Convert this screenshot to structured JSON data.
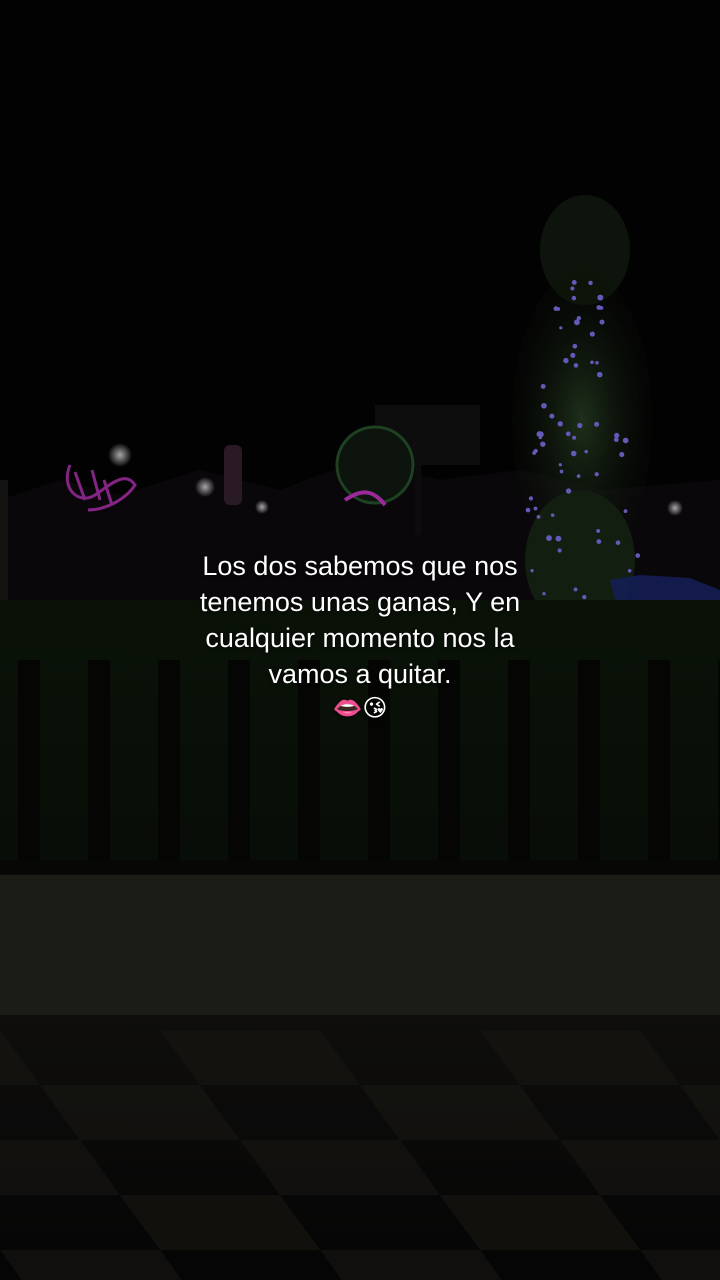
{
  "caption": {
    "lines": [
      "Los dos sabemos que nos",
      "tenemos unas ganas, Y en",
      "cualquier momento nos la",
      "vamos a quitar."
    ],
    "emojis": "👄😘"
  },
  "colors": {
    "sky": "#050405",
    "grass": "#0f1a0c",
    "neon_pink": "#d63bd6",
    "tree_lights": "#8a7cff",
    "wall": "#24261f"
  }
}
